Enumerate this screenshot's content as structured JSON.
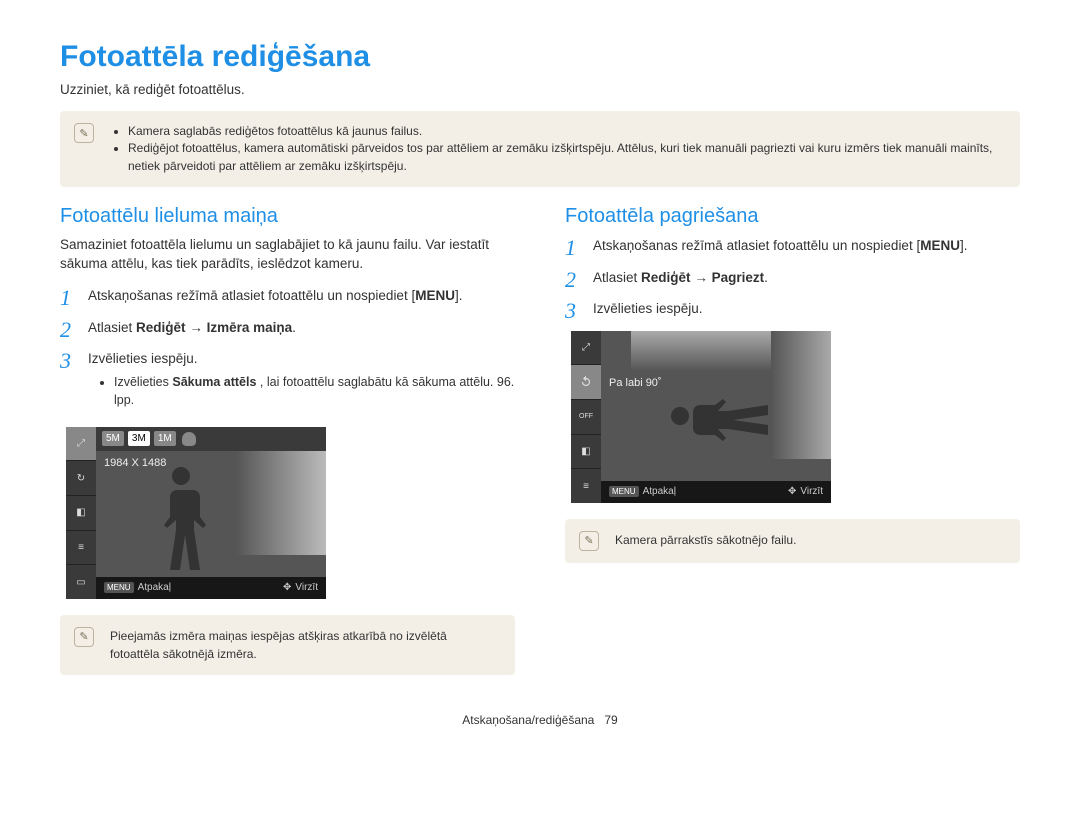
{
  "title": "Fotoattēla rediģēšana",
  "subtitle": "Uzziniet, kā rediģēt fotoattēlus.",
  "top_notes": {
    "bullet1": "Kamera saglabās rediģētos fotoattēlus kā jaunus failus.",
    "bullet2": "Rediģējot fotoattēlus, kamera automātiski pārveidos tos par attēliem ar zemāku izšķirtspēju. Attēlus, kuri tiek manuāli pagriezti vai kuru izmērs tiek manuāli mainīts, netiek pārveidoti par attēliem ar zemāku izšķirtspēju."
  },
  "left": {
    "heading": "Fotoattēlu lieluma maiņa",
    "intro": "Samaziniet fotoattēla lielumu un saglabājiet to kā jaunu failu. Var iestatīt sākuma attēlu, kas tiek parādīts, ieslēdzot kameru.",
    "step1_a": "Atskaņošanas režīmā atlasiet fotoattēlu un nospiediet",
    "menu": "MENU",
    "step2_a": "Atlasiet ",
    "step2_b": "Rediģēt",
    "step2_arrow": " → ",
    "step2_c": "Izmēra maiņa",
    "step3": "Izvēlieties iespēju.",
    "step3_sub_a": "Izvēlieties ",
    "step3_sub_b": "Sākuma attēls",
    "step3_sub_c": ", lai fotoattēlu saglabātu kā sākuma attēlu. 96. lpp.",
    "cam": {
      "opts": {
        "a": "5M",
        "b": "3M",
        "c": "1M"
      },
      "label": "1984 X 1488",
      "back_lbl": "MENU",
      "back": "Atpakaļ",
      "move": "Virzīt"
    },
    "bottom_note": "Pieejamās izmēra maiņas iespējas atšķiras atkarībā no izvēlētā fotoattēla sākotnējā izmēra."
  },
  "right": {
    "heading": "Fotoattēla pagriešana",
    "step1_a": "Atskaņošanas režīmā atlasiet fotoattēlu un nospiediet",
    "menu": "MENU",
    "step2_a": "Atlasiet ",
    "step2_b": "Rediģēt",
    "step2_arrow": " → ",
    "step2_c": "Pagriezt",
    "step3": "Izvēlieties iespēju.",
    "cam": {
      "label": "Pa labi 90˚",
      "back_lbl": "MENU",
      "back": "Atpakaļ",
      "move": "Virzīt"
    },
    "bottom_note": "Kamera pārrakstīs sākotnējo failu."
  },
  "footer": {
    "section": "Atskaņošana/rediģēšana",
    "page": "79"
  },
  "nums": {
    "n1": "1",
    "n2": "2",
    "n3": "3"
  },
  "dot": "."
}
